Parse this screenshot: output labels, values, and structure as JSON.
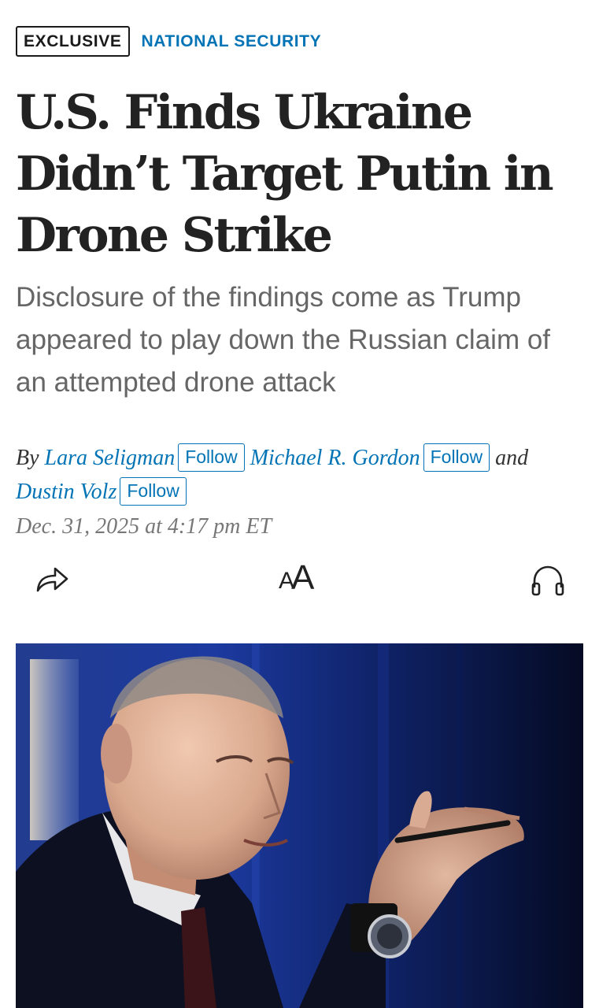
{
  "article": {
    "label": "EXCLUSIVE",
    "section": "NATIONAL SECURITY",
    "headline": "U.S. Finds Ukraine Didn’t Target Putin in Drone Strike",
    "dek": "Disclosure of the findings come as Trump appeared to play down the Russian claim of an attempted drone attack",
    "byline": {
      "by": "By",
      "and": "and",
      "authors": [
        {
          "name": "Lara Seligman",
          "follow": "Follow"
        },
        {
          "name": "Michael R. Gordon",
          "follow": "Follow"
        },
        {
          "name": "Dustin Volz",
          "follow": "Follow"
        }
      ]
    },
    "timestamp": "Dec. 31, 2025 at 4:17 pm ET"
  },
  "toolbar": {
    "icons": [
      "share-icon",
      "text-size-icon",
      "headphones-icon"
    ],
    "text_size_small": "A",
    "text_size_large": "A"
  },
  "colors": {
    "link": "#0274b6",
    "headline": "#222222",
    "dek": "#666666",
    "photo_background": "#0b1636"
  }
}
